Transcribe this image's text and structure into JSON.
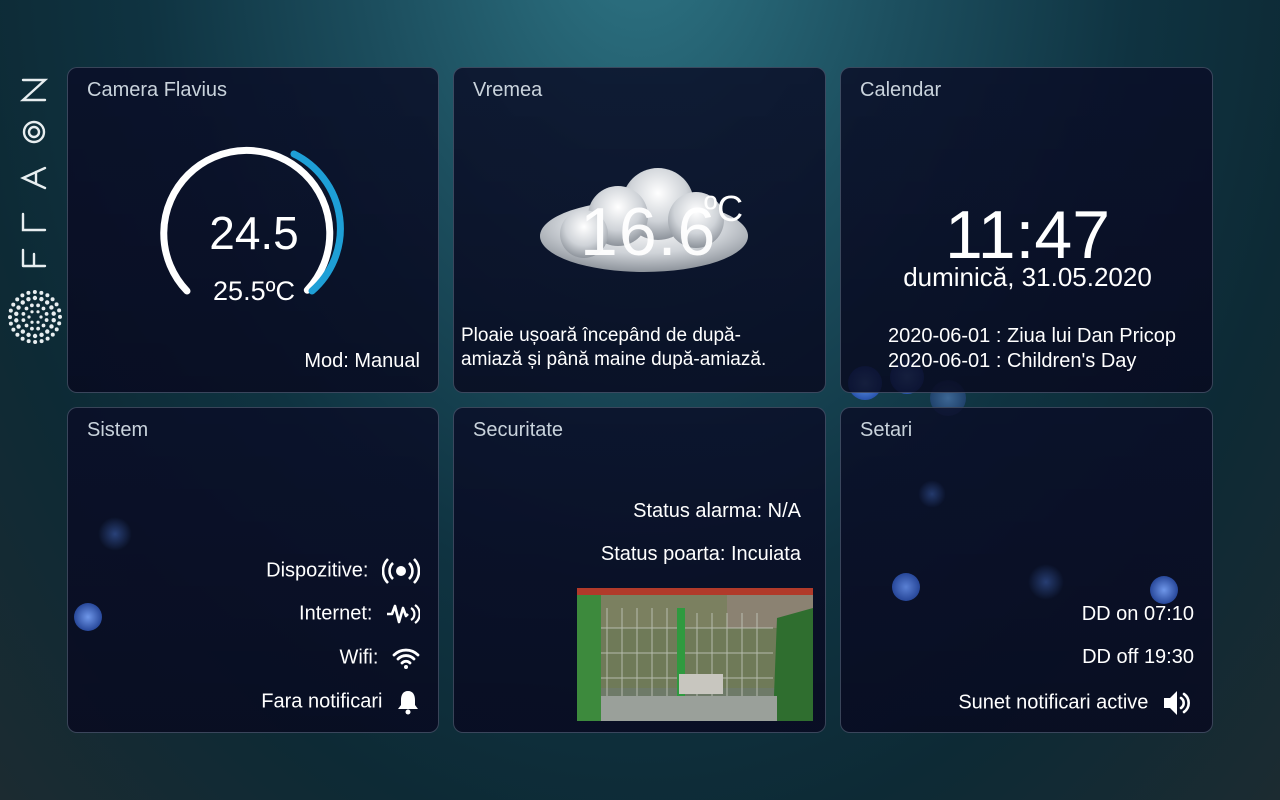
{
  "brand": {
    "name": "FLAON"
  },
  "colors": {
    "accent": "#1e9fd6",
    "card_bg": "#0a0c26",
    "title": "#c9d3dc"
  },
  "thermostat": {
    "title": "Camera Flavius",
    "current": "24.5",
    "target": "25.5ºC",
    "mode": "Mod: Manual"
  },
  "weather": {
    "title": "Vremea",
    "temp": "16.6",
    "unit": "ºC",
    "icon": "cloud-icon",
    "desc_line1": "Ploaie ușoară începând de după-",
    "desc_line2": "amiază și până maine după-amiază."
  },
  "calendar": {
    "title": "Calendar",
    "time": "11:47",
    "date": "duminică, 31.05.2020",
    "events": [
      "2020-06-01 : Ziua lui Dan Pricop",
      "2020-06-01 : Children's Day"
    ]
  },
  "system": {
    "title": "Sistem",
    "devices": "Dispozitive:",
    "internet": "Internet:",
    "wifi": "Wifi:",
    "notifications": "Fara notificari"
  },
  "security": {
    "title": "Securitate",
    "alarm": "Status alarma: N/A",
    "gate": "Status poarta: Incuiata"
  },
  "settings": {
    "title": "Setari",
    "dd_on": "DD on 07:10",
    "dd_off": "DD off 19:30",
    "sound": "Sunet notificari active"
  }
}
